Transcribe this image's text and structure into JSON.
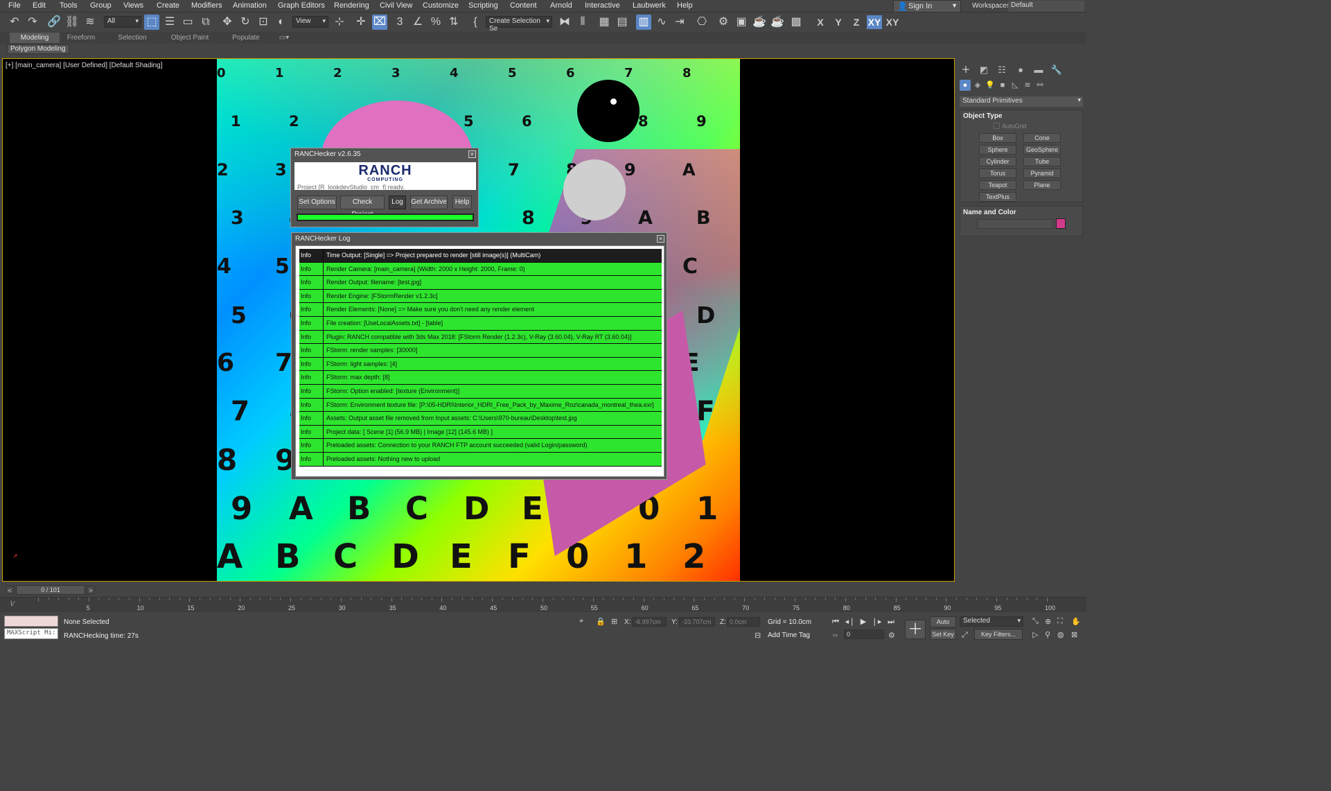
{
  "menubar": {
    "items": [
      "File",
      "Edit",
      "Tools",
      "Group",
      "Views",
      "Create",
      "Modifiers",
      "Animation",
      "Graph Editors",
      "Rendering",
      "Civil View",
      "Customize",
      "Scripting",
      "Content",
      "Arnold",
      "Interactive",
      "Laubwerk",
      "Help"
    ],
    "sign_in": "Sign In",
    "workspaces_label": "Workspaces:",
    "workspaces_value": "Default"
  },
  "toolbar": {
    "filter_value": "All",
    "ref_coord_value": "View",
    "selection_set_value": "Create Selection Se",
    "axes": [
      "X",
      "Y",
      "Z",
      "XY",
      "XY"
    ]
  },
  "ribbon": {
    "tabs": [
      "Modeling",
      "Freeform",
      "Selection",
      "Object Paint",
      "Populate"
    ],
    "panel_button": "Polygon Modeling"
  },
  "viewport": {
    "label": "[+] [main_camera] [User Defined] [Default Shading]"
  },
  "ranch_dialog": {
    "title": "RANCHecker v2.6.35",
    "logo": "RANCH",
    "logo_sub": "COMPUTING",
    "status": "Project [R_lookdevStudio_cm_f] ready.",
    "buttons": [
      "Set Options",
      "Check Project",
      "Log",
      "Get Archive",
      "Help"
    ],
    "progress": 1.0
  },
  "log_dialog": {
    "title": "RANCHecker Log",
    "rows": [
      {
        "level": "Info",
        "message": "Time Output: [Single] => Project prepared to render [still image(s)] (MultiCam)"
      },
      {
        "level": "Info",
        "message": "Render Camera: [main_camera]  (Width: 2000 x Height: 2000, Frame: 0)"
      },
      {
        "level": "Info",
        "message": "Render Output: filename: [test.jpg]"
      },
      {
        "level": "Info",
        "message": "Render Engine: [FStormRender v1.2.3c]"
      },
      {
        "level": "Info",
        "message": "Render Elements: [None] => Make sure you don't need any render element"
      },
      {
        "level": "Info",
        "message": "File creation: [UseLocalAssets.txt] - [table]"
      },
      {
        "level": "Info",
        "message": "Plugin: RANCH compatible with 3ds Max 2018: [FStorm Render (1.2.3c), V-Ray (3.60.04), V-Ray RT (3.60.04)]"
      },
      {
        "level": "Info",
        "message": "FStorm: render samples: [30000]"
      },
      {
        "level": "Info",
        "message": "FStorm: light samples: [4]"
      },
      {
        "level": "Info",
        "message": "FStorm: max depth: [8]"
      },
      {
        "level": "Info",
        "message": "FStorm: Option enabled: [texture (Environment)]"
      },
      {
        "level": "Info",
        "message": "FStorm: Environment texture file: [P:\\05-HDRI\\Interior_HDRI_Free_Pack_by_Maxime_Roz\\canada_montreal_thea.exr]"
      },
      {
        "level": "Info",
        "message": "Assets: Output asset file removed from Input assets: C:\\Users\\970-bureau\\Desktop\\test.jpg"
      },
      {
        "level": "Info",
        "message": "Project data: [ Scene [1] (56.9 MB)  |  Image [12] (145.6 MB) ]"
      },
      {
        "level": "Info",
        "message": "Preloaded assets: Connection to your RANCH FTP account succeeded (valid Login/password)"
      },
      {
        "level": "Info",
        "message": "Preloaded assets: Nothing new to upload"
      }
    ]
  },
  "command_panel": {
    "category": "Standard Primitives",
    "object_type_title": "Object Type",
    "autogrid": "AutoGrid",
    "object_buttons": [
      "Box",
      "Cone",
      "Sphere",
      "GeoSphere",
      "Cylinder",
      "Tube",
      "Torus",
      "Pyramid",
      "Teapot",
      "Plane",
      "TextPlus"
    ],
    "name_color_title": "Name and Color",
    "object_color": "#d43a8c"
  },
  "timeline": {
    "frame_display": "0 / 101",
    "ticks": [
      "5",
      "10",
      "15",
      "20",
      "25",
      "30",
      "35",
      "40",
      "45",
      "50",
      "55",
      "60",
      "65",
      "70",
      "75",
      "80",
      "85",
      "90",
      "95",
      "100"
    ]
  },
  "status": {
    "maxscript_placeholder": "MAXScript Mi:",
    "selection": "None Selected",
    "prompt": "RANCHecking time: 27s",
    "x_label": "X:",
    "x_value": "-6.997cm",
    "y_label": "Y:",
    "y_value": "-33.707cm",
    "z_label": "Z:",
    "z_value": "0.0cm",
    "grid": "Grid = 10.0cm",
    "add_time_tag": "Add Time Tag",
    "frame_value": "0",
    "auto_key": "Auto Key",
    "set_key": "Set Key",
    "selected_value": "Selected",
    "key_filters": "Key Filters..."
  }
}
